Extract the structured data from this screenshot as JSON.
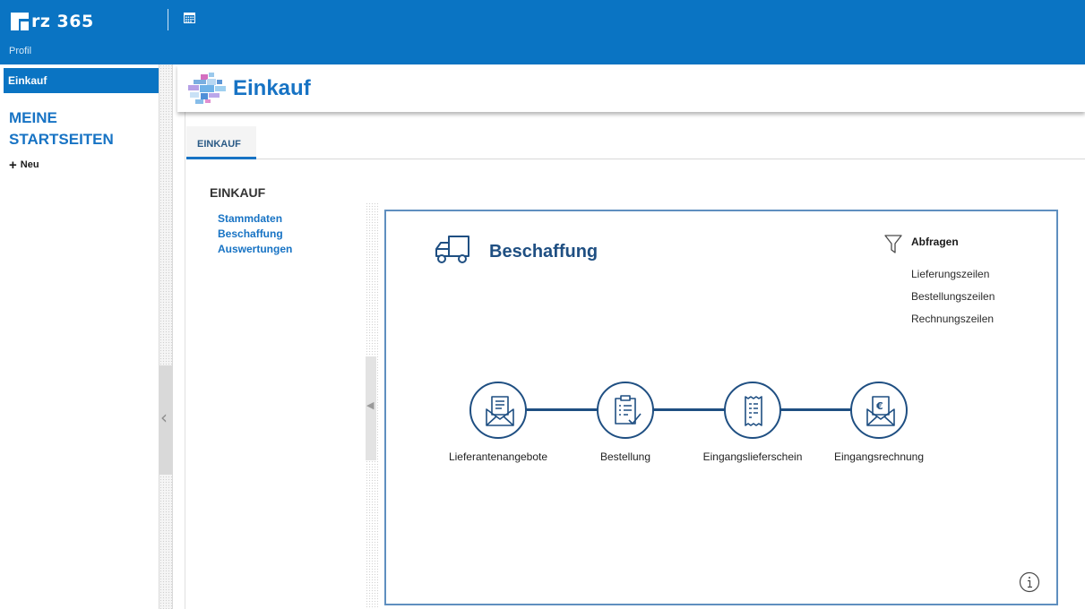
{
  "app": {
    "logo_text": "rz 365",
    "profile_label": "Profil"
  },
  "sidebar": {
    "active_item": "Einkauf",
    "heading_line1": "MEINE",
    "heading_line2": "STARTSEITEN",
    "new_label": "Neu"
  },
  "header": {
    "title": "Einkauf"
  },
  "tabs": [
    {
      "label": "EINKAUF"
    }
  ],
  "section": {
    "title": "EINKAUF",
    "links": [
      "Stammdaten",
      "Beschaffung",
      "Auswertungen"
    ]
  },
  "panel": {
    "title": "Beschaffung",
    "queries_title": "Abfragen",
    "queries": [
      "Lieferungszeilen",
      "Bestellungszeilen",
      "Rechnungszeilen"
    ],
    "steps": [
      {
        "label": "Lieferantenangebote",
        "icon": "envelope-document-icon"
      },
      {
        "label": "Bestellung",
        "icon": "clipboard-check-icon"
      },
      {
        "label": "Eingangslieferschein",
        "icon": "receipt-icon"
      },
      {
        "label": "Eingangsrechnung",
        "icon": "envelope-euro-icon"
      }
    ]
  },
  "colors": {
    "brand_blue": "#0a74c3",
    "link_blue": "#1773c4",
    "dark_blue": "#1f4f82",
    "panel_border": "#5f8fbf"
  }
}
